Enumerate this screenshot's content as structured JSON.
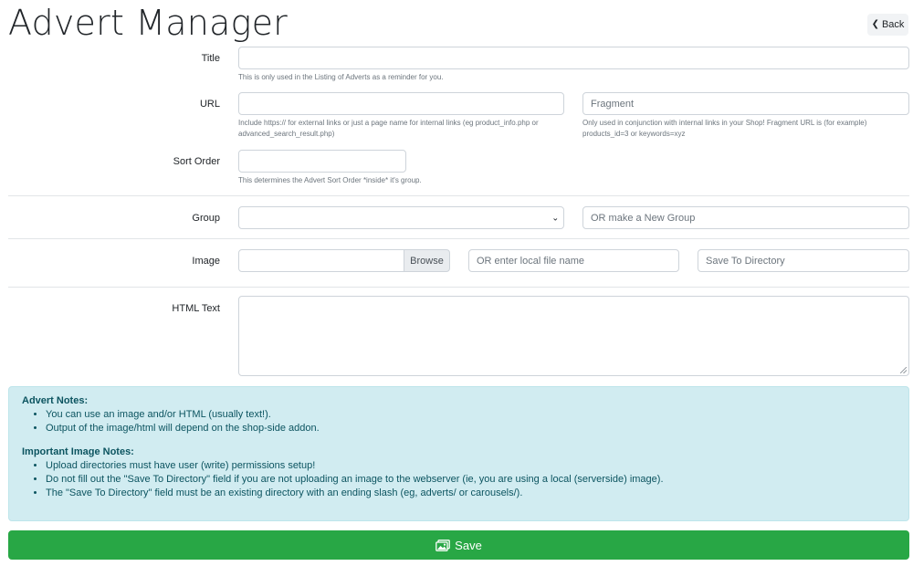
{
  "header": {
    "title": "Advert Manager",
    "back_label": "Back",
    "back_icon": "chevron-left-icon"
  },
  "form": {
    "title": {
      "label": "Title",
      "value": "",
      "help": "This is only used in the Listing of Adverts as a reminder for you."
    },
    "url": {
      "label": "URL",
      "value": "",
      "help": "Include https:// for external links or just a page name for internal links (eg product_info.php or advanced_search_result.php)",
      "fragment_placeholder": "Fragment",
      "fragment_help": "Only used in conjunction with internal links in your Shop! Fragment URL is (for example) products_id=3 or keywords=xyz"
    },
    "sort_order": {
      "label": "Sort Order",
      "value": "",
      "help": "This determines the Advert Sort Order *inside* it's group."
    },
    "group": {
      "label": "Group",
      "selected": "",
      "new_group_placeholder": "OR make a New Group"
    },
    "image": {
      "label": "Image",
      "file_value": "",
      "browse_label": "Browse",
      "local_file_placeholder": "OR enter local file name",
      "save_dir_placeholder": "Save To Directory"
    },
    "html_text": {
      "label": "HTML Text",
      "value": ""
    }
  },
  "notes": {
    "advert_heading": "Advert Notes:",
    "advert_items": [
      "You can use an image and/or HTML (usually text!).",
      "Output of the image/html will depend on the shop-side addon."
    ],
    "image_heading": "Important Image Notes:",
    "image_items": [
      "Upload directories must have user (write) permissions setup!",
      "Do not fill out the \"Save To Directory\" field if you are not uploading an image to the webserver (ie, you are using a local (serverside) image).",
      "The \"Save To Directory\" field must be an existing directory with an ending slash (eg, adverts/ or carousels/)."
    ]
  },
  "actions": {
    "save_label": "Save",
    "save_icon": "image-icon"
  },
  "colors": {
    "accent": "#28a745",
    "info_bg": "#d1ecf1",
    "info_text": "#0c5460"
  }
}
